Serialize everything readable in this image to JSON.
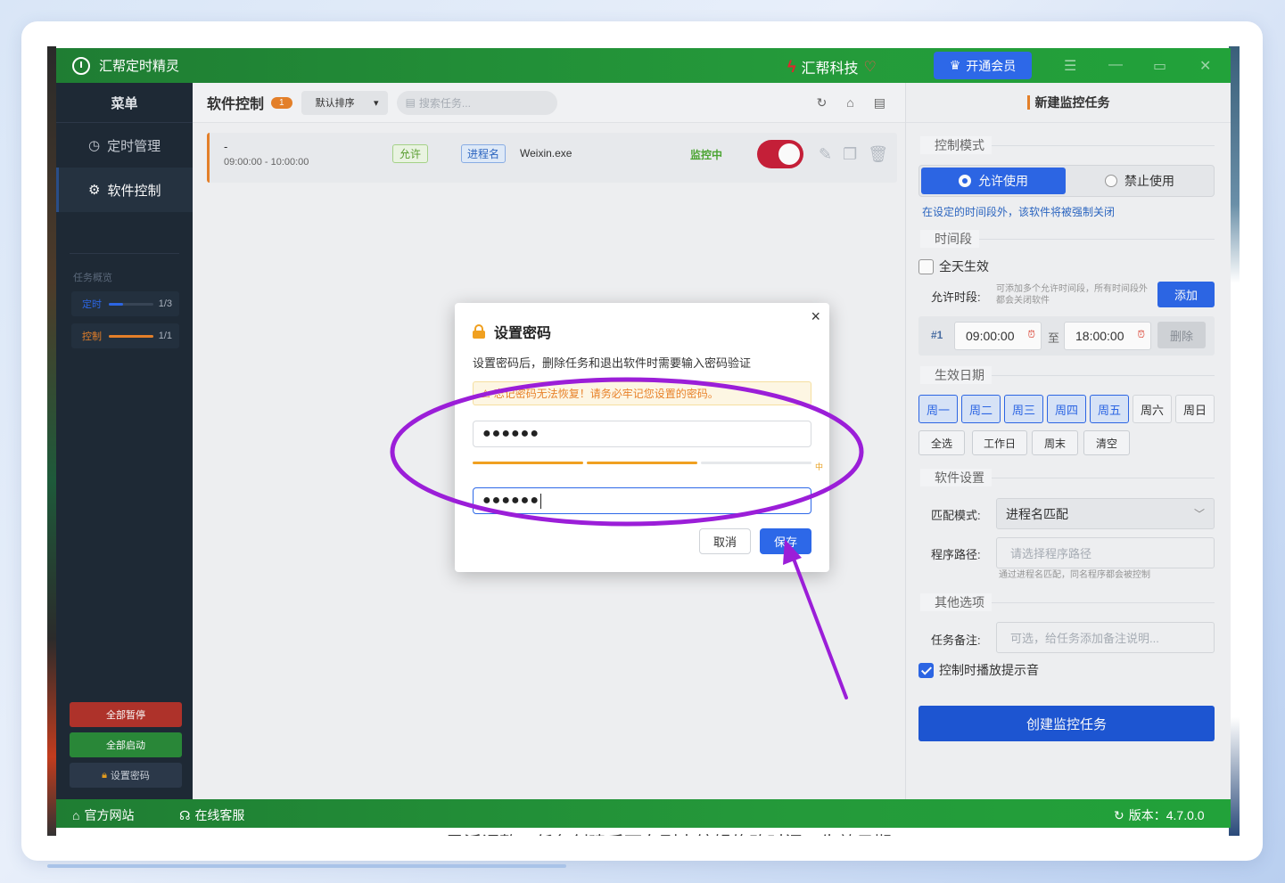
{
  "app": {
    "title": "汇帮定时精灵",
    "brand": "汇帮科技",
    "vip_label": "开通会员"
  },
  "sidebar": {
    "menu_title": "菜单",
    "items": [
      {
        "label": "定时管理",
        "icon": "clock-icon"
      },
      {
        "label": "软件控制",
        "icon": "gear-icon"
      }
    ],
    "overview_title": "任务概览",
    "stats": [
      {
        "label": "定时",
        "count": "1/3",
        "fill": 0.33,
        "color": "#2d68e8"
      },
      {
        "label": "控制",
        "count": "1/1",
        "fill": 1.0,
        "color": "#e8822a"
      }
    ],
    "pause_all": "全部暂停",
    "start_all": "全部启动",
    "set_password": "设置密码"
  },
  "main": {
    "title": "软件控制",
    "count": "1",
    "sort_label": "默认排序",
    "search_placeholder": "搜索任务...",
    "task": {
      "name": "-",
      "time": "09:00:00 - 10:00:00",
      "mode_tag": "允许",
      "match_tag": "进程名",
      "process": "Weixin.exe",
      "status": "监控中",
      "enabled": true
    }
  },
  "right_panel": {
    "title": "新建监控任务",
    "control_mode_label": "控制模式",
    "allow_label": "允许使用",
    "deny_label": "禁止使用",
    "mode_hint": "在设定的时间段外，该软件将被强制关闭",
    "period_label": "时间段",
    "all_day_label": "全天生效",
    "allowed_period_label": "允许时段:",
    "allowed_period_hint": "可添加多个允许时间段，所有时间段外都会关闭软件",
    "add_label": "添加",
    "range": {
      "index": "#1",
      "start": "09:00:00",
      "to": "至",
      "end": "18:00:00",
      "delete": "删除"
    },
    "date_label": "生效日期",
    "days": [
      {
        "label": "周一",
        "on": true
      },
      {
        "label": "周二",
        "on": true
      },
      {
        "label": "周三",
        "on": true
      },
      {
        "label": "周四",
        "on": true
      },
      {
        "label": "周五",
        "on": true
      },
      {
        "label": "周六",
        "on": false
      },
      {
        "label": "周日",
        "on": false
      }
    ],
    "quick": [
      "全选",
      "工作日",
      "周末",
      "清空"
    ],
    "software_settings_label": "软件设置",
    "match_mode_label": "匹配模式:",
    "match_mode_value": "进程名匹配",
    "path_label": "程序路径:",
    "path_placeholder": "请选择程序路径",
    "path_hint": "通过进程名匹配，同名程序都会被控制",
    "other_label": "其他选项",
    "note_label": "任务备注:",
    "note_placeholder": "可选，给任务添加备注说明...",
    "sound_label": "控制时播放提示音",
    "sound_checked": true,
    "create_label": "创建监控任务"
  },
  "footer": {
    "website": "官方网站",
    "support": "在线客服",
    "version": "版本：4.7.0.0"
  },
  "dialog": {
    "title": "设置密码",
    "description": "设置密码后，删除任务和退出软件时需要输入密码验证",
    "warning": "忘记密码无法恢复！请务必牢记您设置的密码。",
    "password": "●●●●●●",
    "confirm_password": "●●●●●●",
    "strength_label": "中",
    "strength_level": 0.67,
    "cancel_label": "取消",
    "save_label": "保存"
  },
  "annotation": {
    "color": "#9b1ed8"
  },
  "background": {
    "partial_text": "灵活调整，任务创建后可在列表编辑修改时间、生效日期"
  }
}
